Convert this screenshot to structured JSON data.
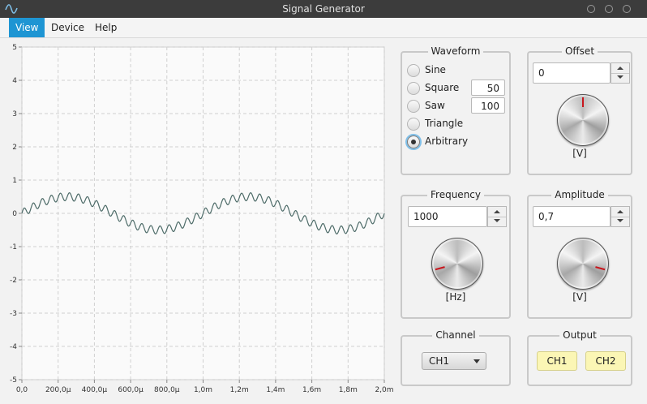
{
  "window": {
    "title": "Signal Generator"
  },
  "menu": {
    "items": [
      "View",
      "Device",
      "Help"
    ],
    "active": 0
  },
  "chart_data": {
    "type": "line",
    "x_ticks": [
      "0,0",
      "200,0µ",
      "400,0µ",
      "600,0µ",
      "800,0µ",
      "1,0m",
      "1,2m",
      "1,4m",
      "1,6m",
      "1,8m",
      "2,0m"
    ],
    "y_ticks": [
      "5",
      "4",
      "3",
      "2",
      "1",
      "0",
      "-1",
      "-2",
      "-3",
      "-4",
      "-5"
    ],
    "xlim": [
      0,
      0.002
    ],
    "ylim": [
      -5,
      5
    ],
    "grid": true,
    "series": [
      {
        "frequency_hz": 1000,
        "amplitude": 0.5,
        "harmonic_multiple": 20,
        "harmonic_amplitude": 0.12,
        "color": "#4d6b68"
      }
    ]
  },
  "waveform": {
    "title": "Waveform",
    "options": [
      "Sine",
      "Square",
      "Saw",
      "Triangle",
      "Arbitrary"
    ],
    "selected": "Arbitrary",
    "square_value": "50",
    "saw_value": "100"
  },
  "offset": {
    "title": "Offset",
    "value": "0",
    "unit": "[V]",
    "knob_angle": 0
  },
  "frequency": {
    "title": "Frequency",
    "value": "1000",
    "unit": "[Hz]",
    "knob_angle": -105
  },
  "amplitude": {
    "title": "Amplitude",
    "value": "0,7",
    "unit": "[V]",
    "knob_angle": 105
  },
  "channel": {
    "title": "Channel",
    "selected": "CH1"
  },
  "output": {
    "title": "Output",
    "buttons": [
      "CH1",
      "CH2"
    ]
  },
  "colors": {
    "accent": "#1e95d3",
    "output_button": "#fbf6b5",
    "knob_marker": "#c8161d"
  }
}
